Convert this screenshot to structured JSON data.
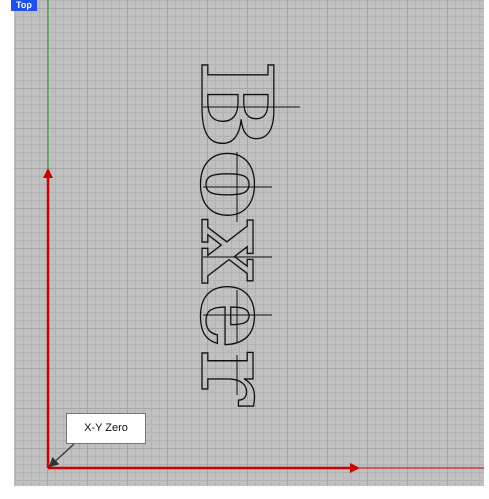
{
  "viewport": {
    "label": "Top",
    "label_color": "#1e4ff0",
    "grid_color": "#c0c0c0",
    "x_axis_color": "#cc0000",
    "y_axis_color": "#2a9a2a"
  },
  "text_object": {
    "text": "Boxer",
    "letters": [
      "B",
      "o",
      "x",
      "e",
      "r"
    ],
    "orientation": "rotated 90° clockwise",
    "style": "outline"
  },
  "annotation": {
    "label": "X-Y Zero"
  }
}
